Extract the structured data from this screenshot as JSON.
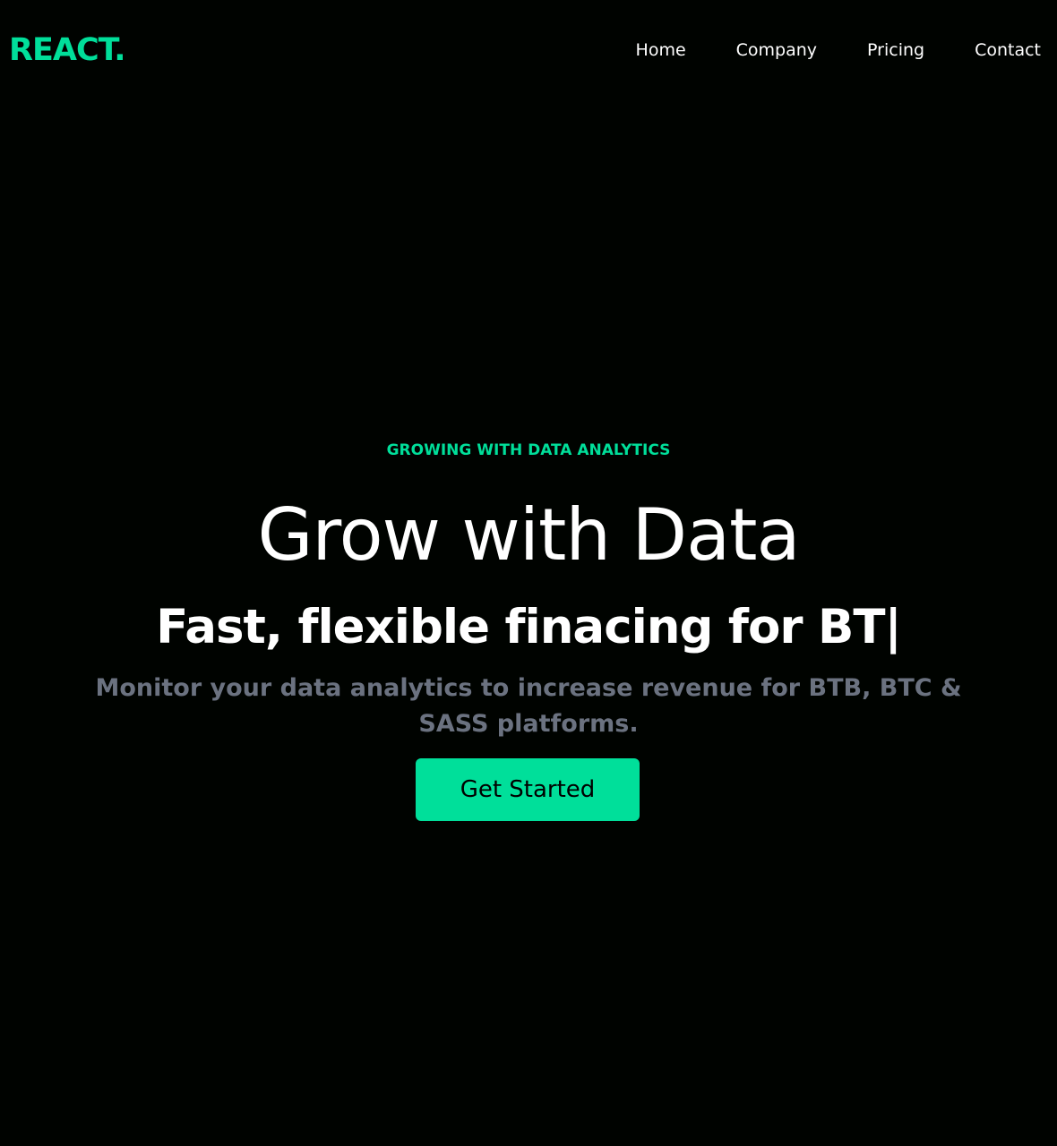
{
  "nav": {
    "logo": "REACT.",
    "items": [
      {
        "label": "Home"
      },
      {
        "label": "Company"
      },
      {
        "label": "Pricing"
      },
      {
        "label": "Contact"
      }
    ]
  },
  "hero": {
    "eyebrow": "GROWING WITH DATA ANALYTICS",
    "title": "Grow with Data",
    "subtitle": "Fast, flexible finacing for BT|",
    "description": "Monitor your data analytics to increase revenue for BTB, BTC & SASS platforms.",
    "cta_label": "Get Started"
  },
  "colors": {
    "background": "#000300",
    "accent": "#00df9a",
    "muted_text": "#6b7280",
    "text": "#ffffff"
  }
}
